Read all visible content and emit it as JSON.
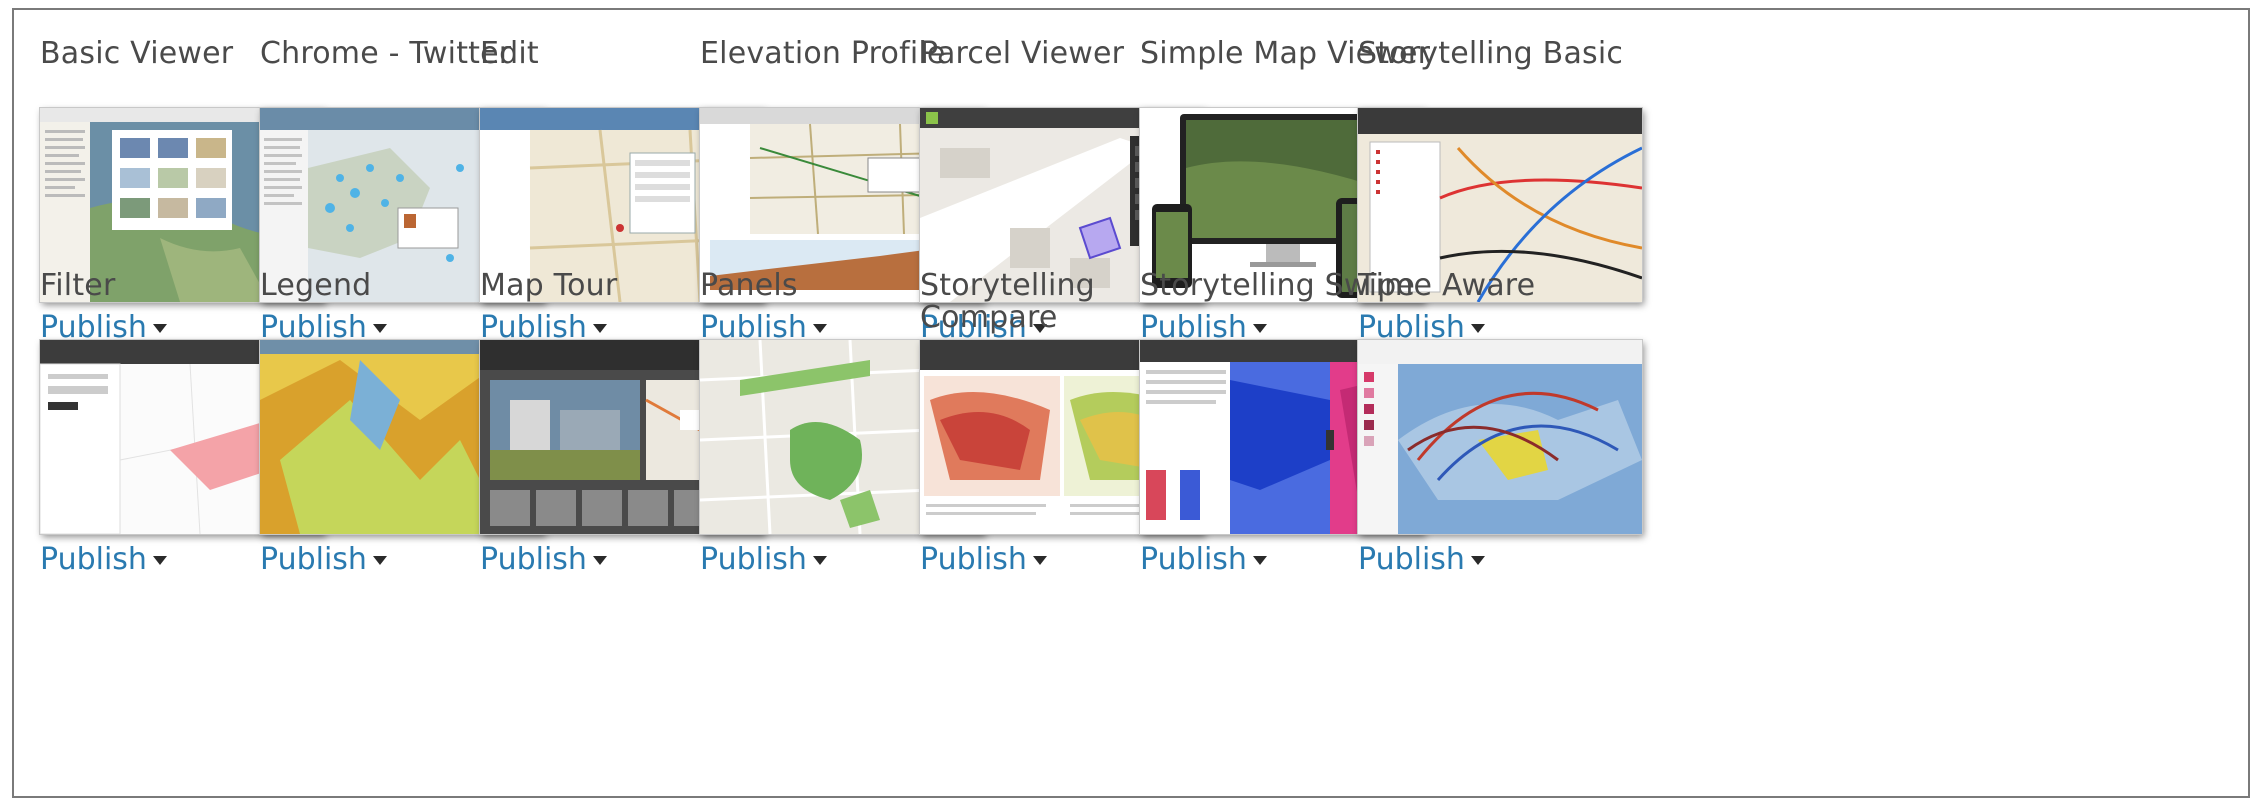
{
  "colors": {
    "accent": "#2a7ab0",
    "title_text": "#4a4a4a"
  },
  "publish_label": "Publish",
  "rows": [
    [
      {
        "title": "Basic Viewer",
        "thumb": "basic-viewer"
      },
      {
        "title": "Chrome - Twitter",
        "thumb": "chrome-twitter"
      },
      {
        "title": "Edit",
        "thumb": "edit"
      },
      {
        "title": "Elevation Profile",
        "thumb": "elevation-profile"
      },
      {
        "title": "Parcel Viewer",
        "thumb": "parcel-viewer"
      },
      {
        "title": "Simple Map Viewer",
        "thumb": "simple-map-viewer"
      },
      {
        "title": "Storytelling Basic",
        "thumb": "storytelling-basic"
      }
    ],
    [
      {
        "title": "Filter",
        "thumb": "filter"
      },
      {
        "title": "Legend",
        "thumb": "legend"
      },
      {
        "title": "Map Tour",
        "thumb": "map-tour"
      },
      {
        "title": "Panels",
        "thumb": "panels"
      },
      {
        "title": "Storytelling Compare",
        "thumb": "storytelling-compare"
      },
      {
        "title": "Storytelling Swipe",
        "thumb": "storytelling-swipe"
      },
      {
        "title": "Time Aware",
        "thumb": "time-aware"
      }
    ]
  ]
}
